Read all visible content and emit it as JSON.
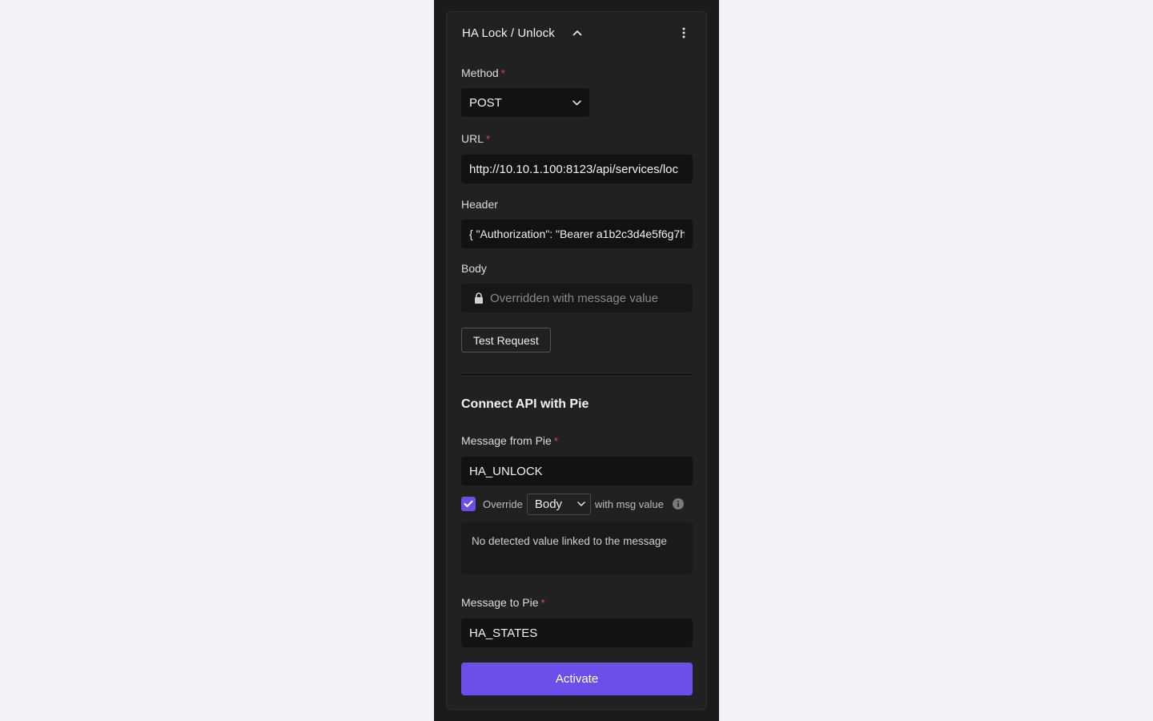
{
  "colors": {
    "page_bg": "#f2f3f7",
    "panel_bg": "#1b1b1b",
    "card_bg": "#212121",
    "input_bg": "#121212",
    "accent": "#6c4fe8",
    "required": "#e5484d"
  },
  "card": {
    "title": "HA Lock / Unlock",
    "collapse_icon": "chevron-up-icon",
    "menu_icon": "more-vertical-icon"
  },
  "method": {
    "label": "Method",
    "required_mark": "*",
    "value": "POST"
  },
  "url": {
    "label": "URL",
    "required_mark": "*",
    "value": "http://10.10.1.100:8123/api/services/loc"
  },
  "header": {
    "label": "Header",
    "value": "{ \"Authorization\": \"Bearer a1b2c3d4e5f6g7h"
  },
  "body": {
    "label": "Body",
    "icon": "lock-icon",
    "placeholder": "Overridden with message value"
  },
  "test_button": {
    "label": "Test Request"
  },
  "connect_section": {
    "title": "Connect API with Pie",
    "message_from": {
      "label": "Message from Pie",
      "required_mark": "*",
      "value": "HA_UNLOCK"
    },
    "override": {
      "checked": true,
      "label": "Override",
      "selected": "Body",
      "suffix": "with msg value",
      "info_icon": "info-icon"
    },
    "notice": "No detected value linked to the message",
    "message_to": {
      "label": "Message to Pie",
      "required_mark": "*",
      "value": "HA_STATES"
    }
  },
  "activate_button": {
    "label": "Activate"
  }
}
